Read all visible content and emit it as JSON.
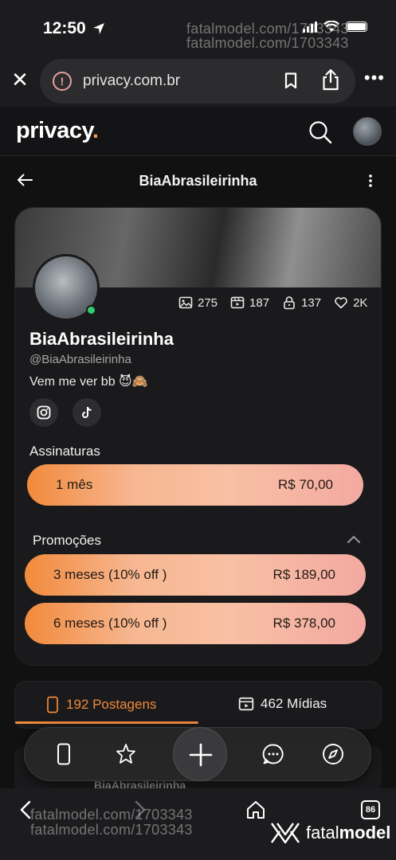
{
  "status_bar": {
    "time": "12:50"
  },
  "watermark": {
    "text_top": "fatalmodel.com/1703343",
    "text_bottom": "fatalmodel.com/1703343"
  },
  "browser": {
    "url": "privacy.com.br",
    "tabs_count": "86"
  },
  "site": {
    "logo": "privacy",
    "logo_dot": "."
  },
  "profile_nav": {
    "title": "BiaAbrasileirinha"
  },
  "profile": {
    "name": "BiaAbrasileirinha",
    "handle": "@BiaAbrasileirinha",
    "bio": "Vem me ver bb 😈🙈",
    "stats": {
      "photos": "275",
      "videos": "187",
      "locked": "137",
      "likes": "2K"
    }
  },
  "subscriptions": {
    "label": "Assinaturas",
    "plans": [
      {
        "name": "1 mês",
        "price": "R$ 70,00"
      }
    ]
  },
  "promotions": {
    "label": "Promoções",
    "plans": [
      {
        "name": "3 meses (10% off )",
        "price": "R$ 189,00"
      },
      {
        "name": "6 meses (10% off )",
        "price": "R$ 378,00"
      }
    ]
  },
  "tabs": [
    {
      "label": "192 Postagens",
      "active": true
    },
    {
      "label": "462 Mídias",
      "active": false
    }
  ],
  "post_peek": {
    "author": "BiaAbrasileirinha"
  },
  "brand": {
    "prefix": "fatal",
    "suffix": "model"
  },
  "colors": {
    "accent": "#f18a3c",
    "online": "#2ecc71"
  }
}
